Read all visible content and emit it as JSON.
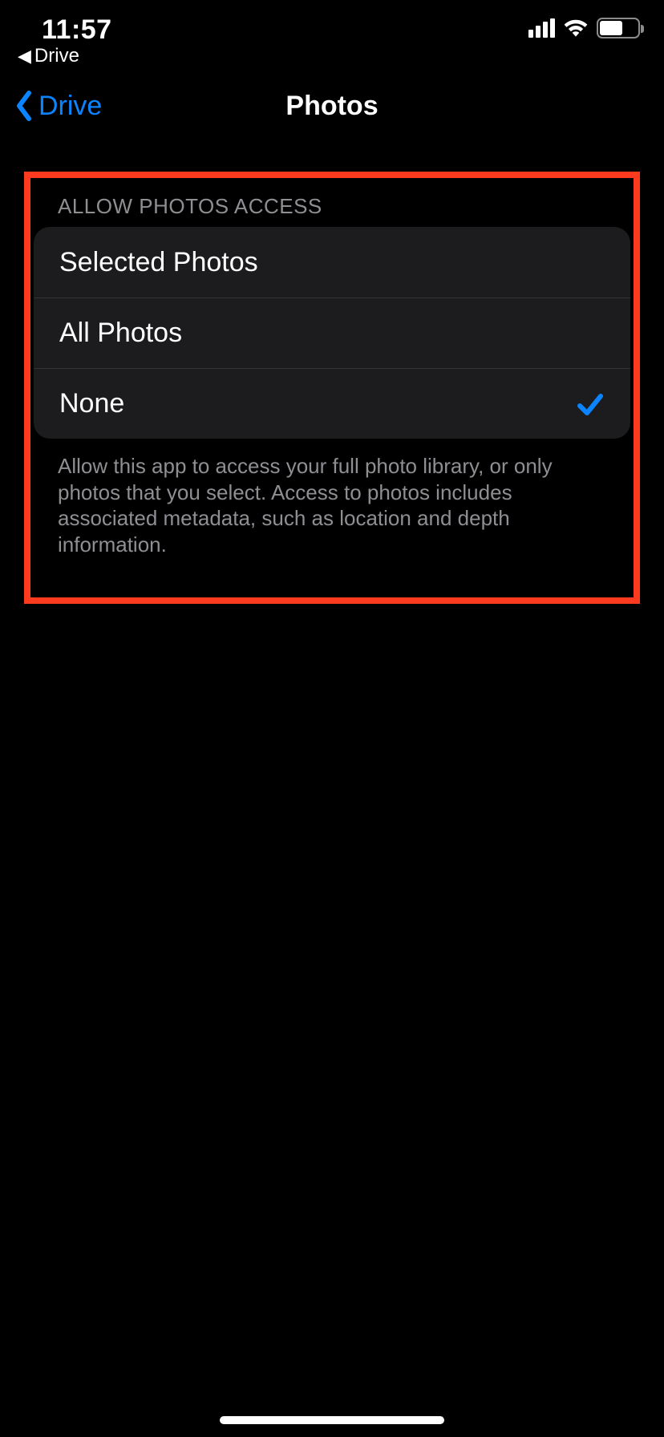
{
  "status": {
    "time": "11:57",
    "return_app": "Drive"
  },
  "nav": {
    "back_label": "Drive",
    "title": "Photos"
  },
  "section": {
    "header": "ALLOW PHOTOS ACCESS",
    "options": [
      {
        "label": "Selected Photos",
        "selected": false
      },
      {
        "label": "All Photos",
        "selected": false
      },
      {
        "label": "None",
        "selected": true
      }
    ],
    "footer": "Allow this app to access your full photo library, or only photos that you select. Access to photos includes associated metadata, such as location and depth information."
  }
}
